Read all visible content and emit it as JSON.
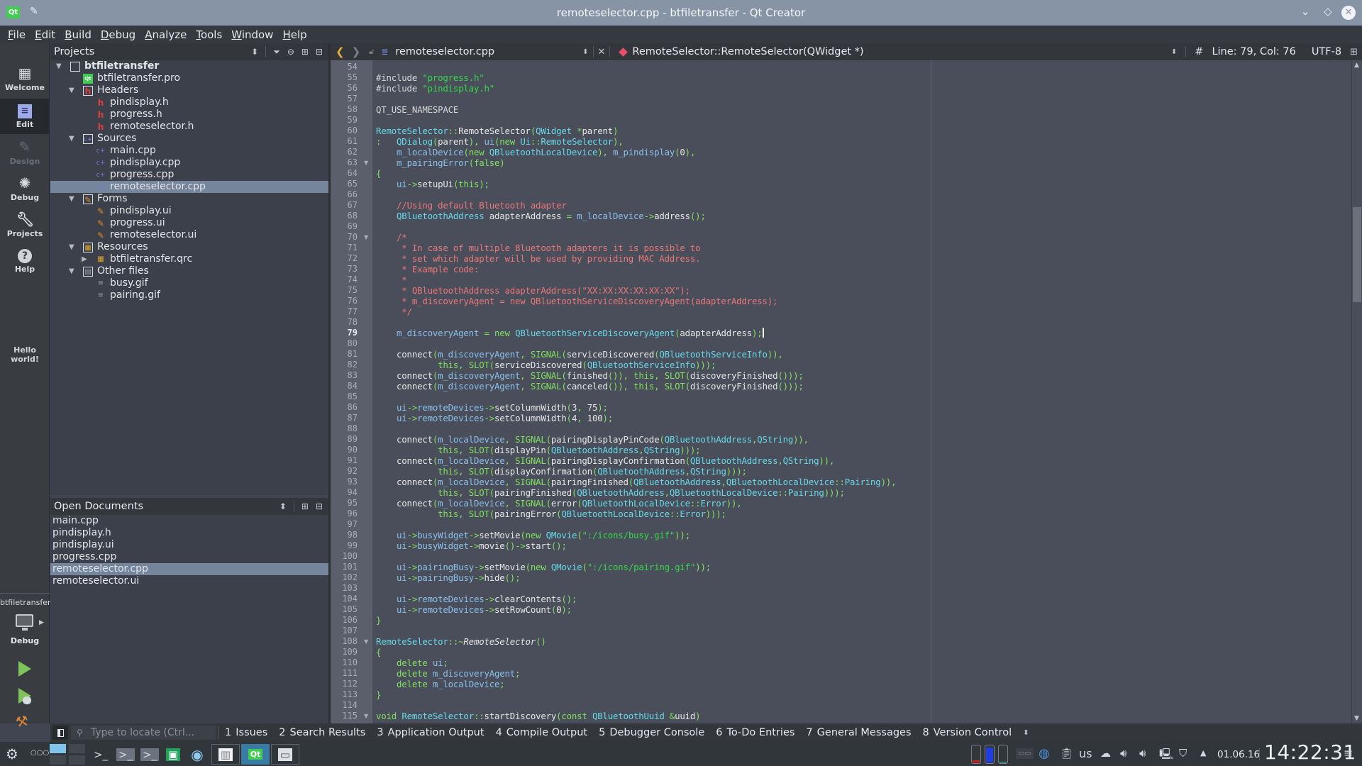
{
  "window": {
    "title": "remoteselector.cpp - btfiletransfer - Qt Creator",
    "app_logo": "Qt",
    "controls": {
      "minimize": "⌄",
      "maximize": "◇",
      "close": "✕"
    }
  },
  "menubar": {
    "items": [
      {
        "label": "File",
        "mnemonic": "F"
      },
      {
        "label": "Edit",
        "mnemonic": "E"
      },
      {
        "label": "Build",
        "mnemonic": "B"
      },
      {
        "label": "Debug",
        "mnemonic": "D"
      },
      {
        "label": "Analyze",
        "mnemonic": "A"
      },
      {
        "label": "Tools",
        "mnemonic": "T"
      },
      {
        "label": "Window",
        "mnemonic": "W"
      },
      {
        "label": "Help",
        "mnemonic": "H"
      }
    ]
  },
  "modes": {
    "items": [
      {
        "label": "Welcome",
        "icon": "grid-icon",
        "state": "normal"
      },
      {
        "label": "Edit",
        "icon": "edit-icon",
        "state": "active"
      },
      {
        "label": "Design",
        "icon": "pencil-icon",
        "state": "disabled"
      },
      {
        "label": "Debug",
        "icon": "bug-icon",
        "state": "normal"
      },
      {
        "label": "Projects",
        "icon": "wrench-icon",
        "state": "normal"
      },
      {
        "label": "Help",
        "icon": "help-icon",
        "state": "normal"
      }
    ],
    "hello": "Hello world!",
    "kit": {
      "project": "btfiletransfer",
      "build_mode": "Debug"
    }
  },
  "projects": {
    "title": "Projects",
    "tree": [
      {
        "label": "btfiletransfer",
        "level": 0,
        "expanded": true,
        "icon": "project-icon",
        "bold": true
      },
      {
        "label": "btfiletransfer.pro",
        "level": 1,
        "icon": "qt-file-icon"
      },
      {
        "label": "Headers",
        "level": 1,
        "expanded": true,
        "icon": "headers-folder-icon"
      },
      {
        "label": "pindisplay.h",
        "level": 2,
        "icon": "header-file-icon"
      },
      {
        "label": "progress.h",
        "level": 2,
        "icon": "header-file-icon"
      },
      {
        "label": "remoteselector.h",
        "level": 2,
        "icon": "header-file-icon"
      },
      {
        "label": "Sources",
        "level": 1,
        "expanded": true,
        "icon": "sources-folder-icon"
      },
      {
        "label": "main.cpp",
        "level": 2,
        "icon": "cpp-file-icon"
      },
      {
        "label": "pindisplay.cpp",
        "level": 2,
        "icon": "cpp-file-icon"
      },
      {
        "label": "progress.cpp",
        "level": 2,
        "icon": "cpp-file-icon"
      },
      {
        "label": "remoteselector.cpp",
        "level": 2,
        "icon": "cpp-file-icon",
        "selected": true
      },
      {
        "label": "Forms",
        "level": 1,
        "expanded": true,
        "icon": "forms-folder-icon"
      },
      {
        "label": "pindisplay.ui",
        "level": 2,
        "icon": "ui-file-icon"
      },
      {
        "label": "progress.ui",
        "level": 2,
        "icon": "ui-file-icon"
      },
      {
        "label": "remoteselector.ui",
        "level": 2,
        "icon": "ui-file-icon"
      },
      {
        "label": "Resources",
        "level": 1,
        "expanded": true,
        "icon": "resources-folder-icon"
      },
      {
        "label": "btfiletransfer.qrc",
        "level": 2,
        "expanded": false,
        "icon": "qrc-file-icon"
      },
      {
        "label": "Other files",
        "level": 1,
        "expanded": true,
        "icon": "other-folder-icon"
      },
      {
        "label": "busy.gif",
        "level": 2,
        "icon": "generic-file-icon"
      },
      {
        "label": "pairing.gif",
        "level": 2,
        "icon": "generic-file-icon"
      }
    ]
  },
  "open_documents": {
    "title": "Open Documents",
    "items": [
      {
        "label": "main.cpp"
      },
      {
        "label": "pindisplay.h"
      },
      {
        "label": "pindisplay.ui"
      },
      {
        "label": "progress.cpp"
      },
      {
        "label": "remoteselector.cpp",
        "selected": true
      },
      {
        "label": "remoteselector.ui"
      }
    ]
  },
  "editor": {
    "file": "remoteselector.cpp",
    "symbol": "RemoteSelector::RemoteSelector(QWidget *)",
    "position": "Line: 79, Col: 76",
    "encoding": "UTF-8",
    "line_marker": "#",
    "current_line": 79,
    "scroll_fraction": 0.25,
    "lines": [
      {
        "n": 54,
        "code": ""
      },
      {
        "n": 55,
        "code": "<span class=\"pp\">#include </span><span class=\"s\">\"progress.h\"</span>"
      },
      {
        "n": 56,
        "code": "<span class=\"pp\">#include </span><span class=\"s\">\"pindisplay.h\"</span>"
      },
      {
        "n": 57,
        "code": ""
      },
      {
        "n": 58,
        "code": "<span class=\"pp\">QT_USE_NAMESPACE</span>"
      },
      {
        "n": 59,
        "code": ""
      },
      {
        "n": 60,
        "code": "<span class=\"t\">RemoteSelector</span><span class=\"k\">::</span>RemoteSelector<span class=\"k\">(</span><span class=\"t\">QWidget</span> <span class=\"k\">*</span>parent<span class=\"k\">)</span>"
      },
      {
        "n": 61,
        "code": "<span class=\"k\">:</span>   <span class=\"t\">QDialog</span><span class=\"k\">(</span>parent<span class=\"k\">),</span> <span class=\"m\">ui</span><span class=\"k\">(new</span> <span class=\"t\">Ui</span><span class=\"k\">::</span><span class=\"t\">RemoteSelector</span><span class=\"k\">),</span>"
      },
      {
        "n": 62,
        "code": "    <span class=\"m\">m_localDevice</span><span class=\"k\">(new</span> <span class=\"t\">QBluetoothLocalDevice</span><span class=\"k\">),</span> <span class=\"m\">m_pindisplay</span><span class=\"k\">(</span>0<span class=\"k\">),</span>"
      },
      {
        "n": 63,
        "code": "    <span class=\"m\">m_pairingError</span><span class=\"k\">(false)</span>",
        "fold": true
      },
      {
        "n": 64,
        "code": "<span class=\"k\">{</span>"
      },
      {
        "n": 65,
        "code": "    <span class=\"m\">ui</span><span class=\"k\">-&gt;</span>setupUi<span class=\"k\">(this);</span>"
      },
      {
        "n": 66,
        "code": ""
      },
      {
        "n": 67,
        "code": "    <span class=\"c\">//Using default Bluetooth adapter</span>"
      },
      {
        "n": 68,
        "code": "    <span class=\"t\">QBluetoothAddress</span> adapterAddress <span class=\"k\">=</span> <span class=\"m\">m_localDevice</span><span class=\"k\">-&gt;</span>address<span class=\"k\">();</span>"
      },
      {
        "n": 69,
        "code": ""
      },
      {
        "n": 70,
        "code": "    <span class=\"c\">/*</span>",
        "fold": true
      },
      {
        "n": 71,
        "code": "<span class=\"c\">     * In case of multiple Bluetooth adapters it is possible to</span>"
      },
      {
        "n": 72,
        "code": "<span class=\"c\">     * set which adapter will be used by providing MAC Address.</span>"
      },
      {
        "n": 73,
        "code": "<span class=\"c\">     * Example code:</span>"
      },
      {
        "n": 74,
        "code": "<span class=\"c\">     *</span>"
      },
      {
        "n": 75,
        "code": "<span class=\"c\">     * QBluetoothAddress adapterAddress(\"XX:XX:XX:XX:XX:XX\");</span>"
      },
      {
        "n": 76,
        "code": "<span class=\"c\">     * m_discoveryAgent = new QBluetoothServiceDiscoveryAgent(adapterAddress);</span>"
      },
      {
        "n": 77,
        "code": "<span class=\"c\">     */</span>"
      },
      {
        "n": 78,
        "code": ""
      },
      {
        "n": 79,
        "code": "    <span class=\"m\">m_discoveryAgent</span> <span class=\"k\">=</span> <span class=\"k\">new</span> <span class=\"t\">QBluetoothServiceDiscoveryAgent</span><span class=\"k\">(</span>adapterAddress<span class=\"k\">);</span><span class=\"cursor\"></span>"
      },
      {
        "n": 80,
        "code": ""
      },
      {
        "n": 81,
        "code": "    connect<span class=\"k\">(</span><span class=\"m\">m_discoveryAgent</span><span class=\"k\">,</span> <span class=\"k\">SIGNAL(</span>serviceDiscovered<span class=\"k\">(</span><span class=\"t\">QBluetoothServiceInfo</span><span class=\"k\">)),</span>"
      },
      {
        "n": 82,
        "code": "            <span class=\"k\">this,</span> <span class=\"k\">SLOT(</span>serviceDiscovered<span class=\"k\">(</span><span class=\"t\">QBluetoothServiceInfo</span><span class=\"k\">)));</span>"
      },
      {
        "n": 83,
        "code": "    connect<span class=\"k\">(</span><span class=\"m\">m_discoveryAgent</span><span class=\"k\">,</span> <span class=\"k\">SIGNAL(</span>finished<span class=\"k\">()),</span> <span class=\"k\">this,</span> <span class=\"k\">SLOT(</span>discoveryFinished<span class=\"k\">()));</span>"
      },
      {
        "n": 84,
        "code": "    connect<span class=\"k\">(</span><span class=\"m\">m_discoveryAgent</span><span class=\"k\">,</span> <span class=\"k\">SIGNAL(</span>canceled<span class=\"k\">()),</span> <span class=\"k\">this,</span> <span class=\"k\">SLOT(</span>discoveryFinished<span class=\"k\">()));</span>"
      },
      {
        "n": 85,
        "code": ""
      },
      {
        "n": 86,
        "code": "    <span class=\"m\">ui</span><span class=\"k\">-&gt;</span><span class=\"m\">remoteDevices</span><span class=\"k\">-&gt;</span>setColumnWidth<span class=\"k\">(</span>3<span class=\"k\">,</span> 75<span class=\"k\">);</span>"
      },
      {
        "n": 87,
        "code": "    <span class=\"m\">ui</span><span class=\"k\">-&gt;</span><span class=\"m\">remoteDevices</span><span class=\"k\">-&gt;</span>setColumnWidth<span class=\"k\">(</span>4<span class=\"k\">,</span> 100<span class=\"k\">);</span>"
      },
      {
        "n": 88,
        "code": ""
      },
      {
        "n": 89,
        "code": "    connect<span class=\"k\">(</span><span class=\"m\">m_localDevice</span><span class=\"k\">,</span> <span class=\"k\">SIGNAL(</span>pairingDisplayPinCode<span class=\"k\">(</span><span class=\"t\">QBluetoothAddress</span><span class=\"k\">,</span><span class=\"t\">QString</span><span class=\"k\">)),</span>"
      },
      {
        "n": 90,
        "code": "            <span class=\"k\">this,</span> <span class=\"k\">SLOT(</span>displayPin<span class=\"k\">(</span><span class=\"t\">QBluetoothAddress</span><span class=\"k\">,</span><span class=\"t\">QString</span><span class=\"k\">)));</span>"
      },
      {
        "n": 91,
        "code": "    connect<span class=\"k\">(</span><span class=\"m\">m_localDevice</span><span class=\"k\">,</span> <span class=\"k\">SIGNAL(</span>pairingDisplayConfirmation<span class=\"k\">(</span><span class=\"t\">QBluetoothAddress</span><span class=\"k\">,</span><span class=\"t\">QString</span><span class=\"k\">)),</span>"
      },
      {
        "n": 92,
        "code": "            <span class=\"k\">this,</span> <span class=\"k\">SLOT(</span>displayConfirmation<span class=\"k\">(</span><span class=\"t\">QBluetoothAddress</span><span class=\"k\">,</span><span class=\"t\">QString</span><span class=\"k\">)));</span>"
      },
      {
        "n": 93,
        "code": "    connect<span class=\"k\">(</span><span class=\"m\">m_localDevice</span><span class=\"k\">,</span> <span class=\"k\">SIGNAL(</span>pairingFinished<span class=\"k\">(</span><span class=\"t\">QBluetoothAddress</span><span class=\"k\">,</span><span class=\"t\">QBluetoothLocalDevice</span><span class=\"k\">::</span><span class=\"t\">Pairing</span><span class=\"k\">)),</span>"
      },
      {
        "n": 94,
        "code": "            <span class=\"k\">this,</span> <span class=\"k\">SLOT(</span>pairingFinished<span class=\"k\">(</span><span class=\"t\">QBluetoothAddress</span><span class=\"k\">,</span><span class=\"t\">QBluetoothLocalDevice</span><span class=\"k\">::</span><span class=\"t\">Pairing</span><span class=\"k\">)));</span>"
      },
      {
        "n": 95,
        "code": "    connect<span class=\"k\">(</span><span class=\"m\">m_localDevice</span><span class=\"k\">,</span> <span class=\"k\">SIGNAL(</span>error<span class=\"k\">(</span><span class=\"t\">QBluetoothLocalDevice</span><span class=\"k\">::</span><span class=\"t\">Error</span><span class=\"k\">)),</span>"
      },
      {
        "n": 96,
        "code": "            <span class=\"k\">this,</span> <span class=\"k\">SLOT(</span>pairingError<span class=\"k\">(</span><span class=\"t\">QBluetoothLocalDevice</span><span class=\"k\">::</span><span class=\"t\">Error</span><span class=\"k\">)));</span>"
      },
      {
        "n": 97,
        "code": ""
      },
      {
        "n": 98,
        "code": "    <span class=\"m\">ui</span><span class=\"k\">-&gt;</span><span class=\"m\">busyWidget</span><span class=\"k\">-&gt;</span>setMovie<span class=\"k\">(new</span> <span class=\"t\">QMovie</span><span class=\"k\">(</span><span class=\"s\">\":/icons/busy.gif\"</span><span class=\"k\">));</span>"
      },
      {
        "n": 99,
        "code": "    <span class=\"m\">ui</span><span class=\"k\">-&gt;</span><span class=\"m\">busyWidget</span><span class=\"k\">-&gt;</span>movie<span class=\"k\">()-&gt;</span>start<span class=\"k\">();</span>"
      },
      {
        "n": 100,
        "code": ""
      },
      {
        "n": 101,
        "code": "    <span class=\"m\">ui</span><span class=\"k\">-&gt;</span><span class=\"m\">pairingBusy</span><span class=\"k\">-&gt;</span>setMovie<span class=\"k\">(new</span> <span class=\"t\">QMovie</span><span class=\"k\">(</span><span class=\"s\">\":/icons/pairing.gif\"</span><span class=\"k\">));</span>"
      },
      {
        "n": 102,
        "code": "    <span class=\"m\">ui</span><span class=\"k\">-&gt;</span><span class=\"m\">pairingBusy</span><span class=\"k\">-&gt;</span>hide<span class=\"k\">();</span>"
      },
      {
        "n": 103,
        "code": ""
      },
      {
        "n": 104,
        "code": "    <span class=\"m\">ui</span><span class=\"k\">-&gt;</span><span class=\"m\">remoteDevices</span><span class=\"k\">-&gt;</span>clearContents<span class=\"k\">();</span>"
      },
      {
        "n": 105,
        "code": "    <span class=\"m\">ui</span><span class=\"k\">-&gt;</span><span class=\"m\">remoteDevices</span><span class=\"k\">-&gt;</span>setRowCount<span class=\"k\">(</span>0<span class=\"k\">);</span>"
      },
      {
        "n": 106,
        "code": "<span class=\"k\">}</span>"
      },
      {
        "n": 107,
        "code": ""
      },
      {
        "n": 108,
        "code": "<span class=\"t\">RemoteSelector</span><span class=\"k\">::~</span><i>RemoteSelector</i><span class=\"k\">()</span>",
        "fold": true
      },
      {
        "n": 109,
        "code": "<span class=\"k\">{</span>"
      },
      {
        "n": 110,
        "code": "    <span class=\"k\">delete</span> <span class=\"m\">ui</span><span class=\"k\">;</span>"
      },
      {
        "n": 111,
        "code": "    <span class=\"k\">delete</span> <span class=\"m\">m_discoveryAgent</span><span class=\"k\">;</span>"
      },
      {
        "n": 112,
        "code": "    <span class=\"k\">delete</span> <span class=\"m\">m_localDevice</span><span class=\"k\">;</span>"
      },
      {
        "n": 113,
        "code": "<span class=\"k\">}</span>"
      },
      {
        "n": 114,
        "code": ""
      },
      {
        "n": 115,
        "code": "<span class=\"k\">void</span> <span class=\"t\">RemoteSelector</span><span class=\"k\">::</span>startDiscovery<span class=\"k\">(const</span> <span class=\"t\">QBluetoothUuid</span> <span class=\"k\">&amp;</span>uuid<span class=\"k\">)</span>",
        "fold": true
      }
    ]
  },
  "output_bar": {
    "locator_placeholder": "Type to locate (Ctrl...",
    "tabs": [
      {
        "num": "1",
        "label": "Issues"
      },
      {
        "num": "2",
        "label": "Search Results"
      },
      {
        "num": "3",
        "label": "Application Output"
      },
      {
        "num": "4",
        "label": "Compile Output"
      },
      {
        "num": "5",
        "label": "Debugger Console"
      },
      {
        "num": "6",
        "label": "To-Do Entries"
      },
      {
        "num": "7",
        "label": "General Messages"
      },
      {
        "num": "8",
        "label": "Version Control"
      }
    ]
  },
  "taskbar": {
    "keyboard_layout": "us",
    "date": "01.06.16",
    "time": "14:22:31",
    "meters": [
      {
        "name": "cpu",
        "fraction": 0.1,
        "color": "#d02020"
      },
      {
        "name": "memory",
        "fraction": 0.85,
        "color": "#1f3ee0"
      },
      {
        "name": "swap",
        "fraction": 0.05,
        "color": "#4ac0b0"
      }
    ]
  }
}
